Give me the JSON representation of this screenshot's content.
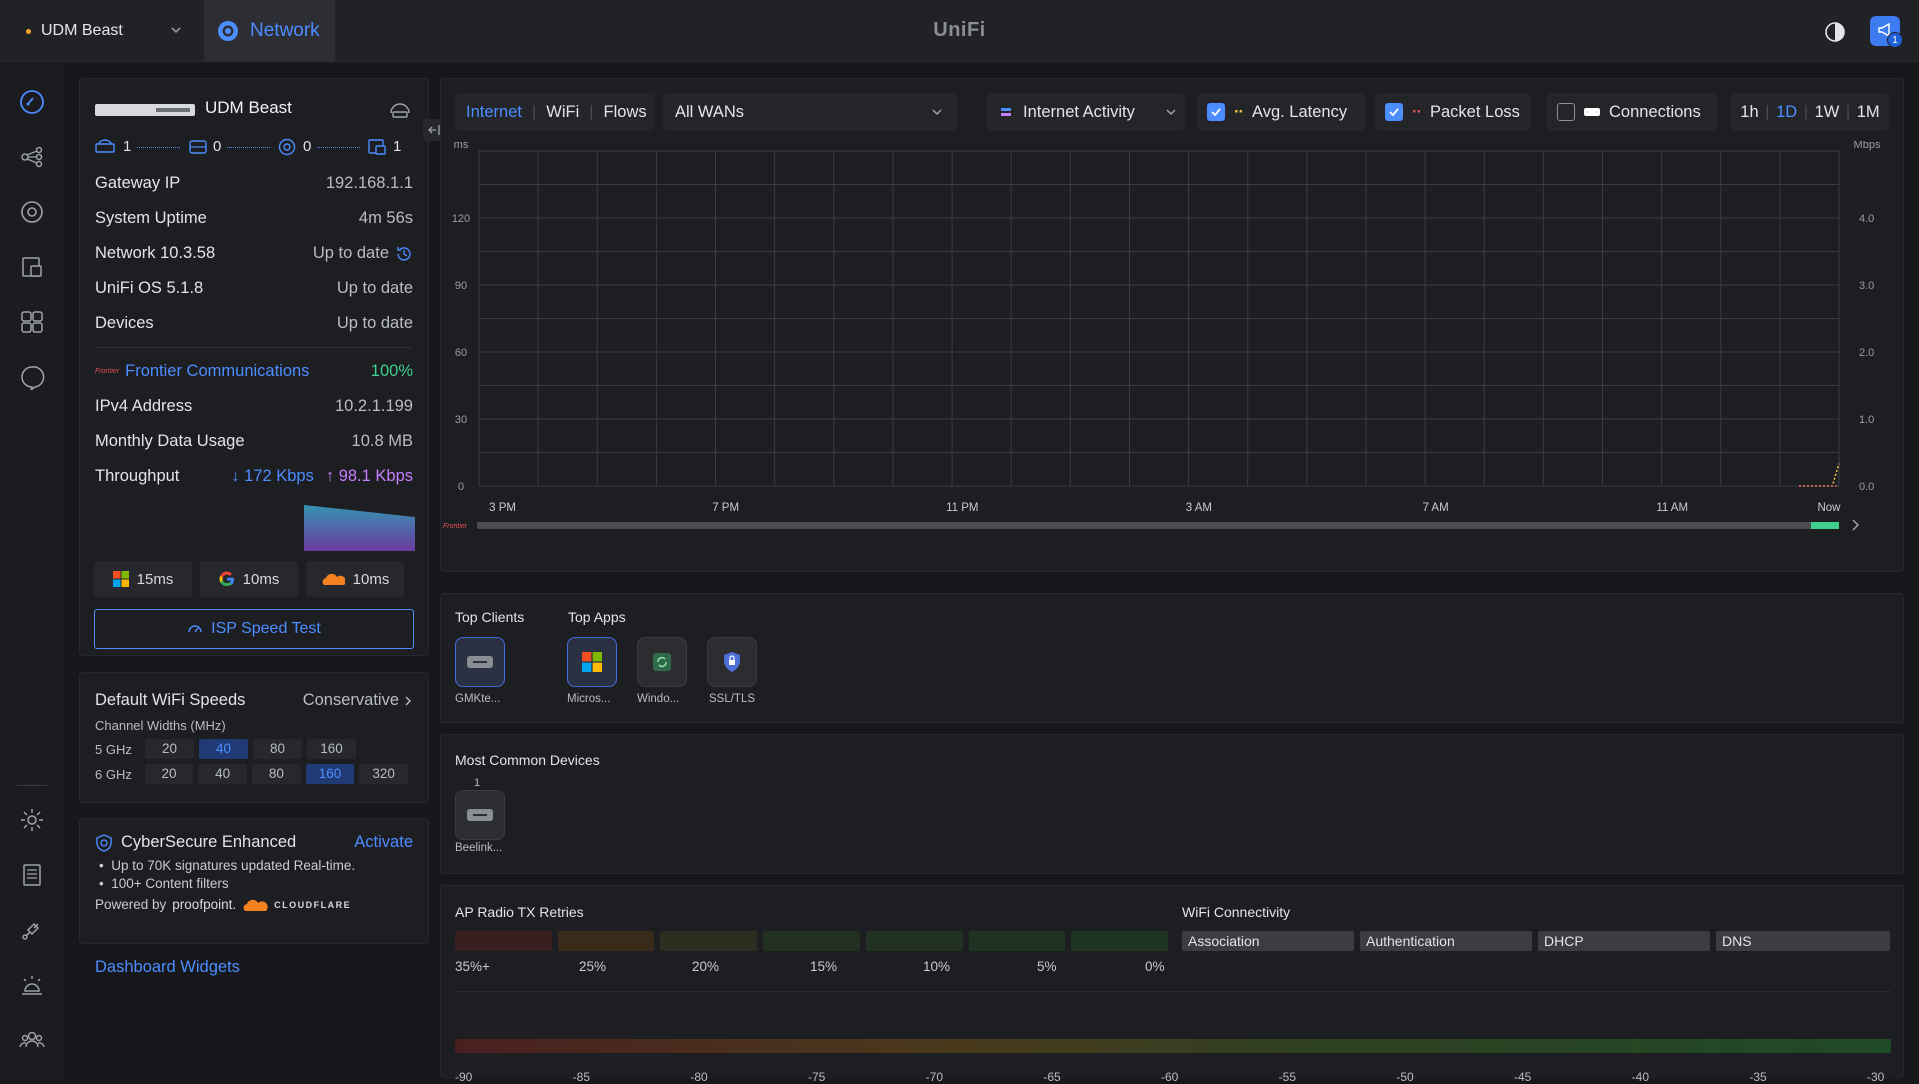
{
  "topbar": {
    "site_name": "UDM Beast",
    "app_name": "Network",
    "brand": "UniFi",
    "notification_count": "1"
  },
  "device": {
    "name": "UDM Beast",
    "topology": [
      "1",
      "0",
      "0",
      "1"
    ],
    "rows": [
      {
        "k": "Gateway IP",
        "v": "192.168.1.1"
      },
      {
        "k": "System Uptime",
        "v": "4m 56s"
      },
      {
        "k": "Network 10.3.58",
        "v": "Up to date"
      },
      {
        "k": "UniFi OS 5.1.8",
        "v": "Up to date"
      },
      {
        "k": "Devices",
        "v": "Up to date"
      }
    ],
    "isp_logo": "Frontier",
    "isp_name": "Frontier Communications",
    "isp_uptime": "100%",
    "wan_rows": [
      {
        "k": "IPv4 Address",
        "v": "10.2.1.199"
      },
      {
        "k": "Monthly Data Usage",
        "v": "10.8 MB"
      }
    ],
    "throughput_label": "Throughput",
    "down": "172 Kbps",
    "up": "98.1 Kbps",
    "latencies": [
      "15ms",
      "10ms",
      "10ms"
    ],
    "speedtest_label": "ISP Speed Test"
  },
  "wifi_speeds": {
    "title": "Default WiFi Speeds",
    "mode": "Conservative",
    "subtitle": "Channel Widths (MHz)",
    "band5_label": "5 GHz",
    "band5": [
      "20",
      "40",
      "80",
      "160"
    ],
    "band5_selected": "40",
    "band6_label": "6 GHz",
    "band6": [
      "20",
      "40",
      "80",
      "160",
      "320"
    ],
    "band6_selected": "160"
  },
  "cybersecure": {
    "title": "CyberSecure Enhanced",
    "action": "Activate",
    "bullets": [
      "Up to 70K signatures updated Real-time.",
      "100+ Content filters"
    ],
    "powered_by": "Powered by",
    "partner1": "proofpoint.",
    "partner2": "CLOUDFLARE"
  },
  "dashboard_widgets_link": "Dashboard Widgets",
  "chart_toolbar": {
    "tabs": [
      "Internet",
      "WiFi",
      "Flows"
    ],
    "active_tab": "Internet",
    "wan_select": "All WANs",
    "metric_select": "Internet Activity",
    "toggles": [
      {
        "label": "Avg. Latency",
        "checked": true,
        "color": "#f5c542"
      },
      {
        "label": "Packet Loss",
        "checked": true,
        "color": "#e05252"
      },
      {
        "label": "Connections",
        "checked": false,
        "color": "#ffffff"
      }
    ],
    "ranges": [
      "1h",
      "1D",
      "1W",
      "1M"
    ],
    "active_range": "1D"
  },
  "chart_data": {
    "type": "line",
    "left_unit": "ms",
    "right_unit": "Mbps",
    "y_left_ticks": [
      "120",
      "90",
      "60",
      "30",
      "0"
    ],
    "y_right_ticks": [
      "4.0",
      "3.0",
      "2.0",
      "1.0",
      "0.0"
    ],
    "x_ticks": [
      "3 PM",
      "7 PM",
      "11 PM",
      "3 AM",
      "7 AM",
      "11 AM",
      "Now"
    ],
    "timeline_logo": "Frontier",
    "series": [
      {
        "name": "Avg. Latency",
        "color": "#f5c542",
        "values": [
          0,
          0,
          0,
          0,
          0,
          0,
          10
        ]
      },
      {
        "name": "Packet Loss",
        "color": "#e05252",
        "values": [
          0,
          0,
          0,
          0,
          0,
          0,
          0
        ]
      }
    ],
    "ylim_left": [
      0,
      150
    ],
    "ylim_right": [
      0,
      5
    ]
  },
  "top": {
    "clients_title": "Top Clients",
    "apps_title": "Top Apps",
    "clients": [
      {
        "label": "GMKte..."
      }
    ],
    "apps": [
      {
        "label": "Micros..."
      },
      {
        "label": "Windo..."
      },
      {
        "label": "SSL/TLS"
      }
    ]
  },
  "common_devices": {
    "title": "Most Common Devices",
    "count": "1",
    "label": "Beelink..."
  },
  "ap_retries": {
    "title": "AP Radio TX Retries",
    "labels": [
      "35%+",
      "25%",
      "20%",
      "15%",
      "10%",
      "5%",
      "0%"
    ]
  },
  "wifi_connectivity": {
    "title": "WiFi Connectivity",
    "stages": [
      "Association",
      "Authentication",
      "DHCP",
      "DNS"
    ]
  },
  "signal_scale": [
    "-90",
    "-85",
    "-80",
    "-75",
    "-70",
    "-65",
    "-60",
    "-55",
    "-50",
    "-45",
    "-40",
    "-35",
    "-30"
  ]
}
